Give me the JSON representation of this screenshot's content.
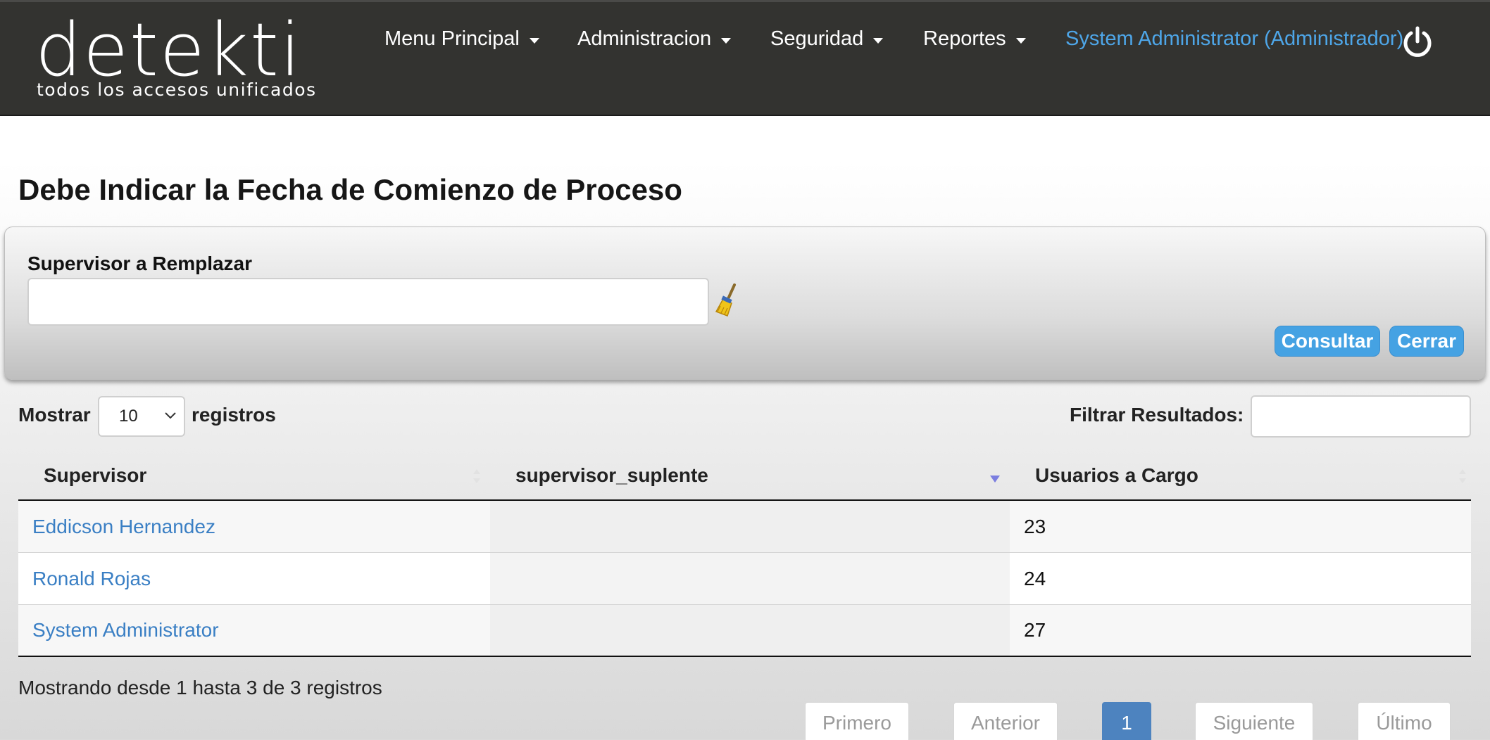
{
  "brand": {
    "word": "detekti",
    "tagline": "todos los accesos unificados"
  },
  "nav": {
    "menu_principal": "Menu Principal",
    "administracion": "Administracion",
    "seguridad": "Seguridad",
    "reportes": "Reportes",
    "user": "System Administrator (Administrador)",
    "power_icon": "power-icon"
  },
  "page": {
    "title": "Debe Indicar la Fecha de Comienzo de Proceso"
  },
  "filter_panel": {
    "label": "Supervisor a Remplazar",
    "input_value": "",
    "clear_icon": "broom-icon",
    "consultar": "Consultar",
    "cerrar": "Cerrar"
  },
  "table_controls": {
    "show_prefix": "Mostrar",
    "page_length": "10",
    "show_suffix": "registros",
    "filter_label": "Filtrar Resultados:",
    "filter_value": ""
  },
  "table": {
    "columns": [
      "Supervisor",
      "supervisor_suplente",
      "Usuarios a Cargo"
    ],
    "rows": [
      {
        "supervisor": "Eddicson Hernandez",
        "suplente": "",
        "usuarios": "23"
      },
      {
        "supervisor": "Ronald Rojas",
        "suplente": "",
        "usuarios": "24"
      },
      {
        "supervisor": "System Administrator",
        "suplente": "",
        "usuarios": "27"
      }
    ],
    "info": "Mostrando desde 1 hasta 3 de 3 registros"
  },
  "pagination": {
    "first": "Primero",
    "prev": "Anterior",
    "current": "1",
    "next": "Siguiente",
    "last": "Último"
  },
  "colors": {
    "navbar": "#333330",
    "link": "#3a7fc4",
    "user_link": "#4ea6e8",
    "button": "#45a2e3",
    "active_page": "#4d83bf"
  }
}
